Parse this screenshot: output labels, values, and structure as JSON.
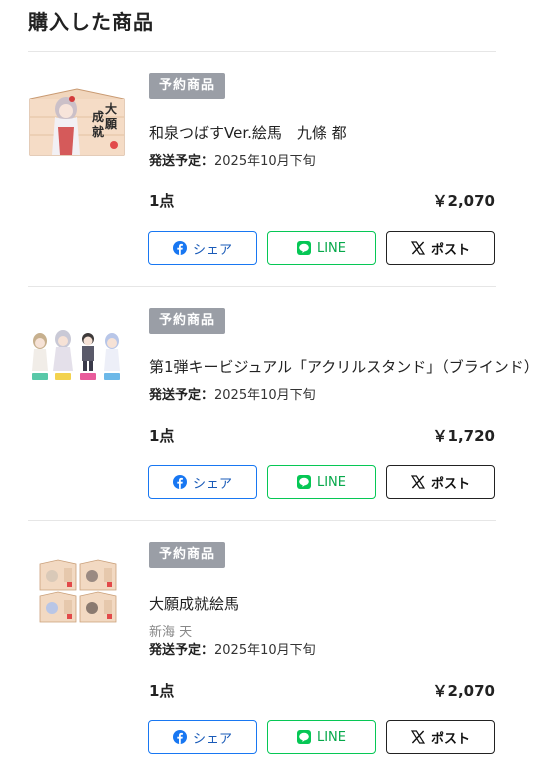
{
  "section_title": "購入した商品",
  "colors": {
    "badge_bg": "#9a9ea6",
    "facebook": "#1877f2",
    "line": "#06c755",
    "x": "#111111"
  },
  "share_buttons": {
    "facebook_label": "シェア",
    "line_label": "LINE",
    "x_label": "ポスト"
  },
  "items": [
    {
      "badge": "予約商品",
      "title": "和泉つばすVer.絵馬　九條 都",
      "subtitle": "",
      "shipping_label": "発送予定：",
      "shipping_date": "2025年10月下旬",
      "quantity": "1点",
      "price": "￥2,070",
      "image_text": "大願成就"
    },
    {
      "badge": "予約商品",
      "title": "第1弾キービジュアル「アクリルスタンド」（ブラインド）",
      "subtitle": "",
      "shipping_label": "発送予定：",
      "shipping_date": "2025年10月下旬",
      "quantity": "1点",
      "price": "￥1,720"
    },
    {
      "badge": "予約商品",
      "title": "大願成就絵馬",
      "subtitle": "新海 天",
      "shipping_label": "発送予定：",
      "shipping_date": "2025年10月下旬",
      "quantity": "1点",
      "price": "￥2,070"
    }
  ]
}
